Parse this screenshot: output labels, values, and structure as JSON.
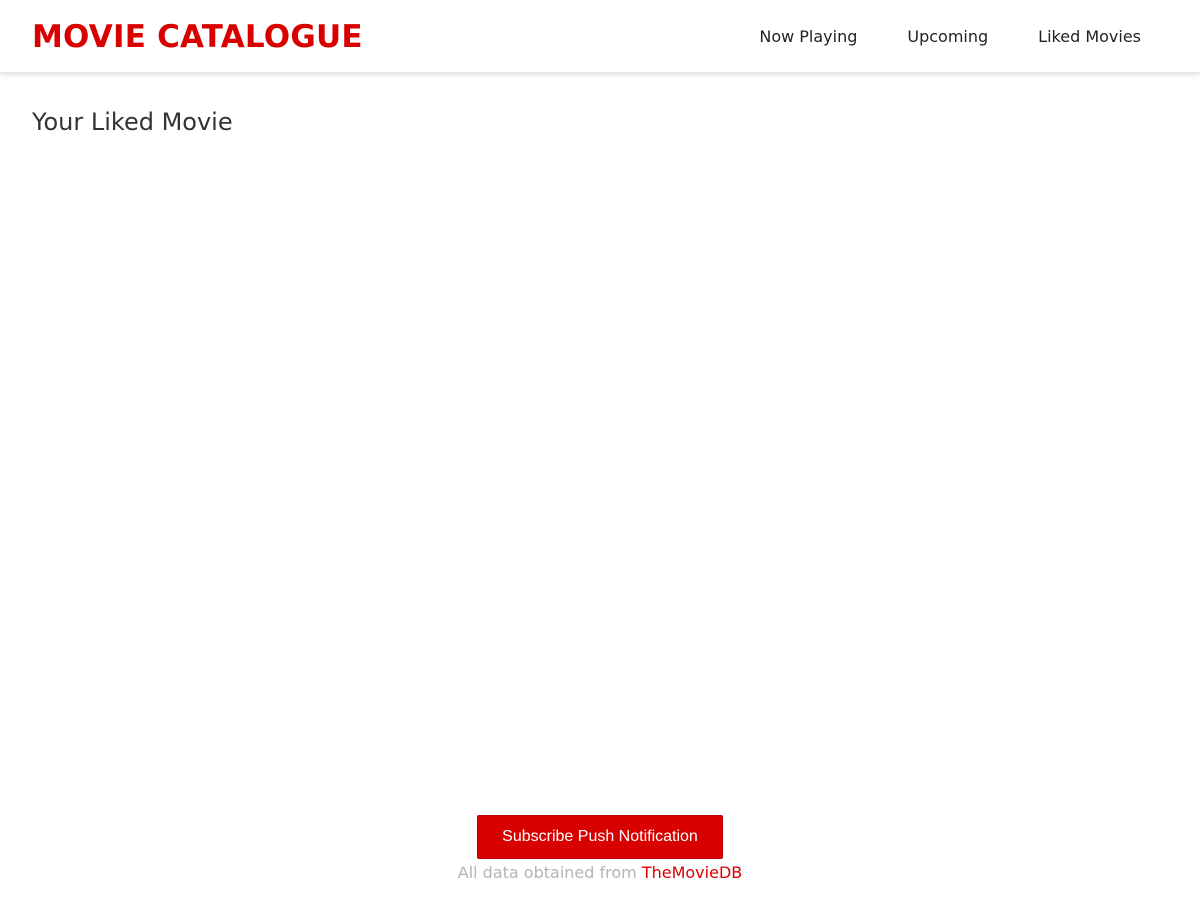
{
  "header": {
    "brand": "MOVIE CATALOGUE",
    "nav": [
      {
        "label": "Now Playing"
      },
      {
        "label": "Upcoming"
      },
      {
        "label": "Liked Movies"
      }
    ]
  },
  "main": {
    "title": "Your Liked Movie"
  },
  "footer": {
    "subscribe_label": "Subscribe Push Notification",
    "credit_text": "All data obtained from",
    "credit_link": "TheMovieDB"
  },
  "colors": {
    "accent": "#d90000",
    "muted_text": "#b5b5b5",
    "background": "#ffffff"
  }
}
